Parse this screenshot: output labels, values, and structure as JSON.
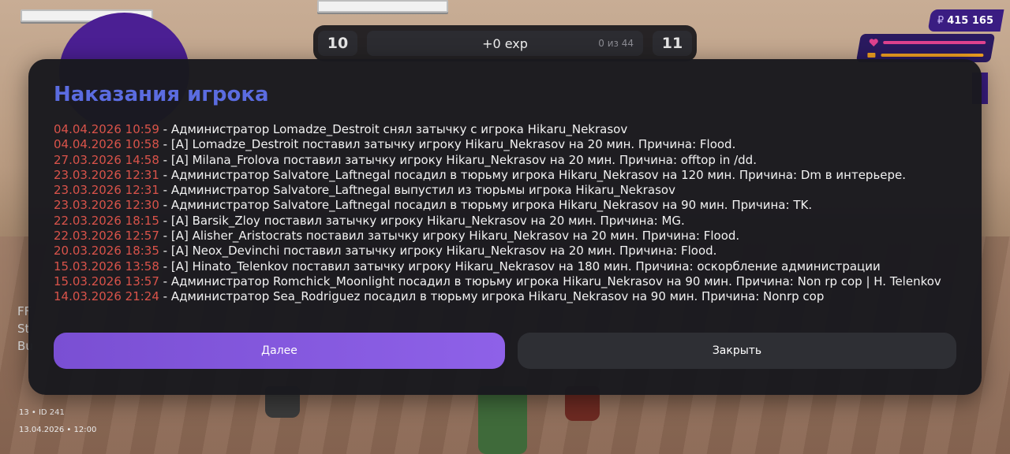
{
  "hud": {
    "level_current": "10",
    "level_next": "11",
    "exp_gain": "+0 exp",
    "exp_progress": "0 из 44",
    "money_symbol": "₽",
    "money": "415 165",
    "health_color": "#e0428f",
    "hunger_color": "#f0a020",
    "server_line": "13 • ID 241",
    "datetime_line": "13.04.2026 • 12:00",
    "faded_lines": [
      "FF",
      "St",
      "Bu"
    ]
  },
  "dialog": {
    "title": "Наказания игрока",
    "entries": [
      {
        "date": "04.04.2026 10:59",
        "text": " - Администратор Lomadze_Destroit снял затычку с игрока Hikaru_Nekrasov"
      },
      {
        "date": "04.04.2026 10:58",
        "text": " - [A] Lomadze_Destroit поставил затычку игроку Hikaru_Nekrasov на 20 мин. Причина: Flood."
      },
      {
        "date": "27.03.2026 14:58",
        "text": " - [A] Milana_Frolova поставил затычку игроку Hikaru_Nekrasov на 20 мин. Причина: offtop in /dd."
      },
      {
        "date": "23.03.2026 12:31",
        "text": " - Администратор Salvatore_Laftnegal посадил в тюрьму игрока Hikaru_Nekrasov на 120 мин. Причина: Dm в интерьере."
      },
      {
        "date": "23.03.2026 12:31",
        "text": " - Администратор Salvatore_Laftnegal выпустил из тюрьмы игрока Hikaru_Nekrasov"
      },
      {
        "date": "23.03.2026 12:30",
        "text": " - Администратор Salvatore_Laftnegal посадил в тюрьму игрока Hikaru_Nekrasov на 90 мин. Причина: TK."
      },
      {
        "date": "22.03.2026 18:15",
        "text": " - [A] Barsik_Zloy поставил затычку игроку Hikaru_Nekrasov на 20 мин. Причина: MG."
      },
      {
        "date": "22.03.2026 12:57",
        "text": " - [A] Alisher_Aristocrats поставил затычку игроку Hikaru_Nekrasov на 20 мин. Причина: Flood."
      },
      {
        "date": "20.03.2026 18:35",
        "text": " - [A] Neox_Devinchi поставил затычку игроку Hikaru_Nekrasov на 20 мин. Причина: Flood."
      },
      {
        "date": "15.03.2026 13:58",
        "text": " - [A] Hinato_Telenkov поставил затычку игроку Hikaru_Nekrasov на 180 мин. Причина: оскорбление администрации"
      },
      {
        "date": "15.03.2026 13:57",
        "text": " - Администратор Romchick_Moonlight посадил в тюрьму игрока Hikaru_Nekrasov на 90 мин. Причина: Non rp cop | H. Telenkov"
      },
      {
        "date": "14.03.2026 21:24",
        "text": " - Администратор Sea_Rodriguez посадил в тюрьму игрока Hikaru_Nekrasov на 90 мин. Причина: Nonrp cop"
      }
    ],
    "next_label": "Далее",
    "close_label": "Закрыть"
  }
}
